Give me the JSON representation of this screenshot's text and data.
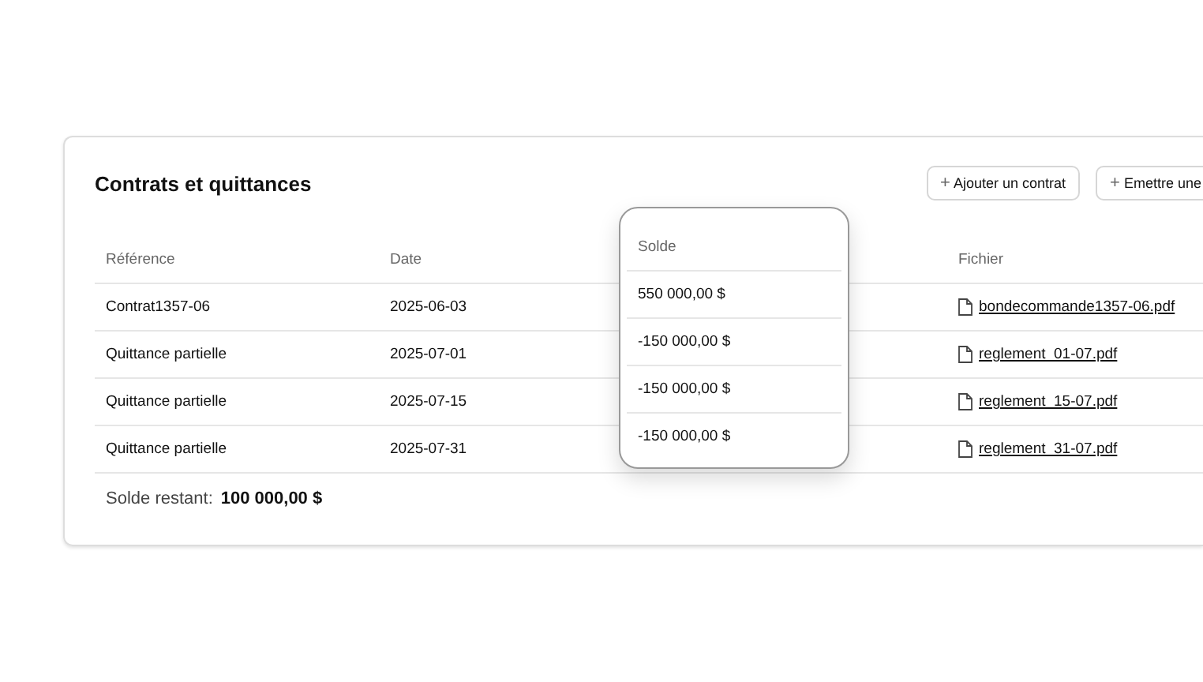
{
  "card": {
    "title": "Contrats et quittances",
    "buttons": [
      {
        "icon": "+",
        "label": "Ajouter un contrat"
      },
      {
        "icon": "+",
        "label": "Emettre une"
      }
    ],
    "table": {
      "columns": [
        "Référence",
        "Date",
        "Solde",
        "Fichier"
      ],
      "rows": [
        {
          "reference": "Contrat1357-06",
          "date": "2025-06-03",
          "solde": "550 000,00 $",
          "file": "bondecommande1357-06.pdf"
        },
        {
          "reference": "Quittance partielle",
          "date": "2025-07-01",
          "solde": "-150 000,00 $",
          "file": "reglement_01-07.pdf"
        },
        {
          "reference": "Quittance partielle",
          "date": "2025-07-15",
          "solde": "-150 000,00 $",
          "file": "reglement_15-07.pdf"
        },
        {
          "reference": "Quittance partielle",
          "date": "2025-07-31",
          "solde": "-150 000,00 $",
          "file": "reglement_31-07.pdf"
        }
      ]
    },
    "remaining": {
      "label": "Solde restant:",
      "value": "100 000,00 $"
    }
  }
}
